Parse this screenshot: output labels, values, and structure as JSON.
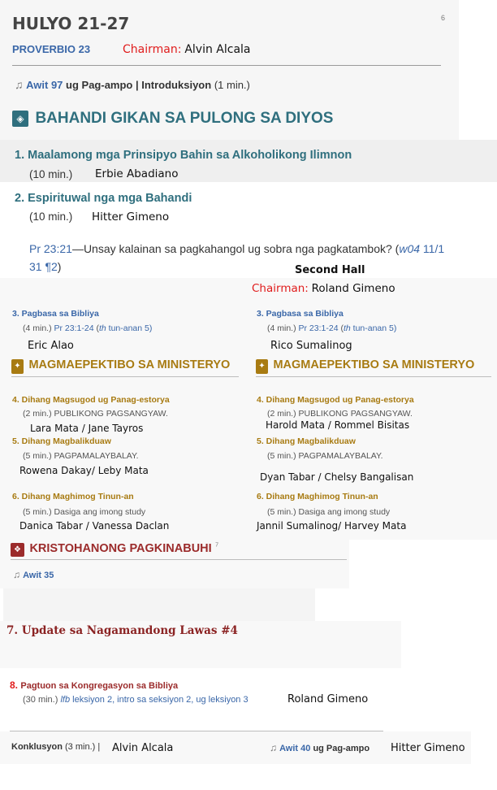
{
  "header": {
    "week": "HULYO 21-27",
    "page_num": "6",
    "reading": "PROVERBIO 23",
    "chairman_label": "Chairman:",
    "chairman_name": "Alvin Alcala",
    "opening_song_num": "Awit 97",
    "opening_text": "ug Pag-ampo | Introduksiyon",
    "opening_time": "(1 min.)"
  },
  "treasures": {
    "title": "BAHANDI GIKAN SA PULONG SA DIYOS",
    "item1_title": "1. Maalamong mga Prinsipyo Bahin sa Alkoholikong Ilimnon",
    "item1_time": "(10 min.)",
    "item1_name": "Erbie Abadiano",
    "item2_title": "2. Espirituwal nga mga Bahandi",
    "item2_time": "(10 min.)",
    "item2_name": "Hitter Gimeno",
    "item2_ref": "Pr 23:21",
    "item2_q": "—Unsay kalainan sa pagkahangol ug sobra nga pagkatambok? (",
    "item2_src": "w04",
    "item2_src2": " 11/1",
    "item2_src3": "31 ¶2",
    "item2_close": ")"
  },
  "second_hall": {
    "title": "Second Hall",
    "chairman_label": "Chairman:",
    "chairman_name": "Roland Gimeno"
  },
  "halls": [
    {
      "reading_title": "3. Pagbasa sa Bibliya",
      "reading_time": "(4 min.)",
      "reading_ref": "Pr 23:1-24",
      "reading_open": "(",
      "reading_th": "th",
      "reading_lesson": "tun-anan 5)",
      "reading_name": "Eric Alao",
      "ministry_title": "MAGMAEPEKTIBO SA MINISTERYO",
      "p4_title": "4. Dihang Magsugod ug Panag-estorya",
      "p4_time": "(2 min.) PUBLIKONG PAGSANGYAW.",
      "p4_name": "Lara Mata / Jane Tayros",
      "p5_title": "5. Dihang Magbalikduaw",
      "p5_time": "(5 min.) PAGPAMALAYBALAY.",
      "p5_name": "Rowena Dakay/ Leby Mata",
      "p6_title": "6. Dihang Maghimog Tinun-an",
      "p6_time": "(5 min.) Dasiga ang imong study",
      "p6_name": "Danica Tabar / Vanessa Daclan"
    },
    {
      "reading_title": "3. Pagbasa sa Bibliya",
      "reading_time": "(4 min.)",
      "reading_ref": "Pr 23:1-24",
      "reading_open": "(",
      "reading_th": "th",
      "reading_lesson": "tun-anan 5)",
      "reading_name": "Rico Sumalinog",
      "ministry_title": "MAGMAEPEKTIBO SA MINISTERYO",
      "p4_title": "4. Dihang Magsugod ug Panag-estorya",
      "p4_time": "(2 min.) PUBLIKONG PAGSANGYAW.",
      "p4_name": "Harold Mata / Rommel Bisitas",
      "p5_title": "5. Dihang Magbalikduaw",
      "p5_time": "(5 min.) PAGPAMALAYBALAY.",
      "p5_name": "Dyan Tabar / Chelsy Bangalisan",
      "p6_title": "6. Dihang Maghimog Tinun-an",
      "p6_time": "(5 min.) Dasiga ang imong study",
      "p6_name": "Jannil Sumalinog/ Harvey Mata"
    }
  ],
  "living": {
    "title": "KRISTOHANONG PAGKINABUHI",
    "sup": "7",
    "song": "Awit 35",
    "item7": "7. Update sa Nagamandong Lawas #4",
    "item8_num": "8.",
    "item8_title": "Pagtuon sa Kongregasyon sa Bibliya",
    "item8_time": "(30 min.)",
    "item8_src": "lfb",
    "item8_rest": "leksiyon 2, intro sa seksiyon 2, ug leksiyon 3",
    "item8_name": "Roland Gimeno"
  },
  "closing": {
    "label": "Konklusyon",
    "time": "(3 min.) |",
    "name": "Alvin Alcala",
    "song": "Awit 40",
    "song_text": "ug Pag-ampo",
    "song_name": "Hitter Gimeno"
  },
  "colors": {
    "blue": "#3a67a8",
    "teal": "#2f6f7e",
    "gold": "#a87b12",
    "maroon": "#9b2b2b",
    "red": "#e01c1c"
  }
}
